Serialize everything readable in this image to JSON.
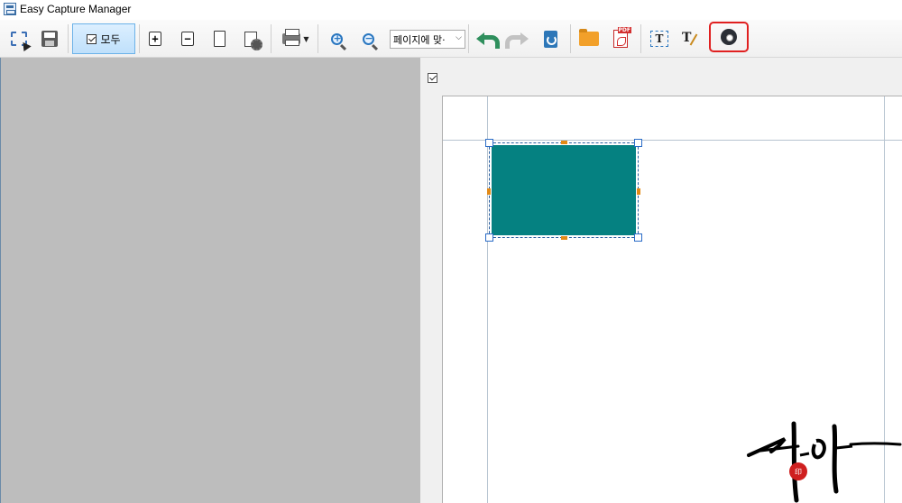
{
  "window": {
    "title": "Easy Capture Manager"
  },
  "toolbar": {
    "select_all_label": "모두",
    "zoom_select_value": "페이지에 맞·",
    "icons": [
      "capture-icon",
      "save-icon",
      "page-add-icon",
      "page-remove-icon",
      "page-icon",
      "page-settings-icon",
      "print-icon",
      "zoom-in-icon",
      "zoom-out-icon",
      "undo-icon",
      "redo-icon",
      "recycle-icon",
      "folder-icon",
      "pdf-icon",
      "text-box-icon",
      "text-edit-icon",
      "gear-icon"
    ],
    "highlight_color": "#e02020"
  },
  "canvas": {
    "shape_color": "#058181",
    "left_panel_color": "#bdbdbd"
  },
  "signature": {
    "seal_color": "#cf1f1f"
  }
}
